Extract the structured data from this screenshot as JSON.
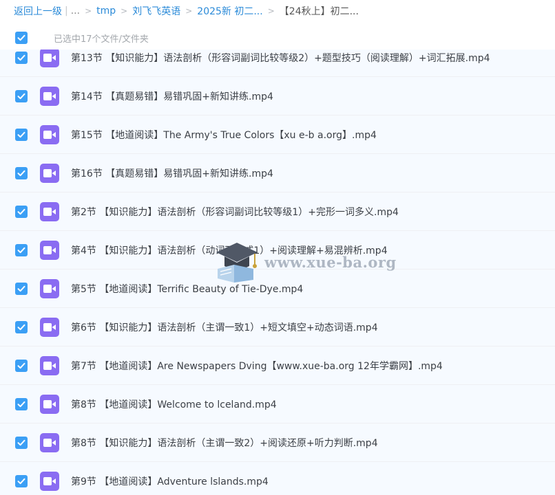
{
  "breadcrumb": {
    "back_label": "返回上一级",
    "more": "...",
    "items": [
      "tmp",
      "刘飞飞英语",
      "2025新 初二...",
      "【24秋上】初二..."
    ]
  },
  "selection": {
    "text": "已选中17个文件/文件夹"
  },
  "files": [
    {
      "name": "第13节 【知识能力】语法剖析（形容词副词比较等级2）+题型技巧（阅读理解）+词汇拓展.mp4"
    },
    {
      "name": "第14节 【真题易错】易错巩固+新知讲练.mp4"
    },
    {
      "name": "第15节 【地道阅读】The Army's True Colors【xu e-b a.org】.mp4"
    },
    {
      "name": "第16节 【真题易错】易错巩固+新知讲练.mp4"
    },
    {
      "name": "第2节 【知识能力】语法剖析（形容词副词比较等级1）+完形一词多义.mp4"
    },
    {
      "name": "第4节 【知识能力】语法剖析（动词不定式1）+阅读理解+易混辨析.mp4"
    },
    {
      "name": "第5节 【地道阅读】Terrific Beauty of Tie-Dye.mp4"
    },
    {
      "name": "第6节 【知识能力】语法剖析（主谓一致1）+短文填空+动态词语.mp4"
    },
    {
      "name": "第7节 【地道阅读】Are Newspapers Dving【www.xue-ba.org 12年学霸网】.mp4"
    },
    {
      "name": "第8节 【地道阅读】Welcome to lceland.mp4"
    },
    {
      "name": "第8节 【知识能力】语法剖析（主谓一致2）+阅读还原+听力判断.mp4"
    },
    {
      "name": "第9节 【地道阅读】Adventure lslands.mp4"
    }
  ],
  "watermark": {
    "text": "www.xue-ba.org"
  },
  "colors": {
    "link": "#2a8ad8",
    "checkbox": "#3b9ff5",
    "video_icon": "#8a6cf2",
    "row_bg": "#f6faff"
  }
}
